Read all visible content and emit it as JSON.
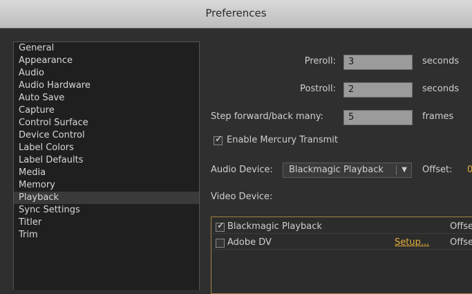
{
  "window": {
    "title": "Preferences"
  },
  "sidebar": {
    "items": [
      {
        "label": "General"
      },
      {
        "label": "Appearance"
      },
      {
        "label": "Audio"
      },
      {
        "label": "Audio Hardware"
      },
      {
        "label": "Auto Save"
      },
      {
        "label": "Capture"
      },
      {
        "label": "Control Surface"
      },
      {
        "label": "Device Control"
      },
      {
        "label": "Label Colors"
      },
      {
        "label": "Label Defaults"
      },
      {
        "label": "Media"
      },
      {
        "label": "Memory"
      },
      {
        "label": "Playback"
      },
      {
        "label": "Sync Settings"
      },
      {
        "label": "Titler"
      },
      {
        "label": "Trim"
      }
    ],
    "selected": "Playback"
  },
  "playback": {
    "preroll_label": "Preroll:",
    "preroll_value": "3",
    "preroll_unit": "seconds",
    "postroll_label": "Postroll:",
    "postroll_value": "2",
    "postroll_unit": "seconds",
    "step_label": "Step forward/back many:",
    "step_value": "5",
    "step_unit": "frames",
    "mercury_label": "Enable Mercury Transmit",
    "mercury_checked": true,
    "audio_device_label": "Audio Device:",
    "audio_device_value": "Blackmagic Playback",
    "offset_label": "Offset:",
    "offset_value_partial": "0",
    "video_device_label": "Video Device:",
    "video_devices": [
      {
        "name": "Blackmagic Playback",
        "checked": true,
        "offset_label": "Offse"
      },
      {
        "name": "Adobe DV",
        "checked": false,
        "setup_label": "Setup...",
        "offset_label": "Offse"
      }
    ]
  },
  "colors": {
    "accent": "#e7b03e",
    "selected_row": "#3a3a3a"
  }
}
